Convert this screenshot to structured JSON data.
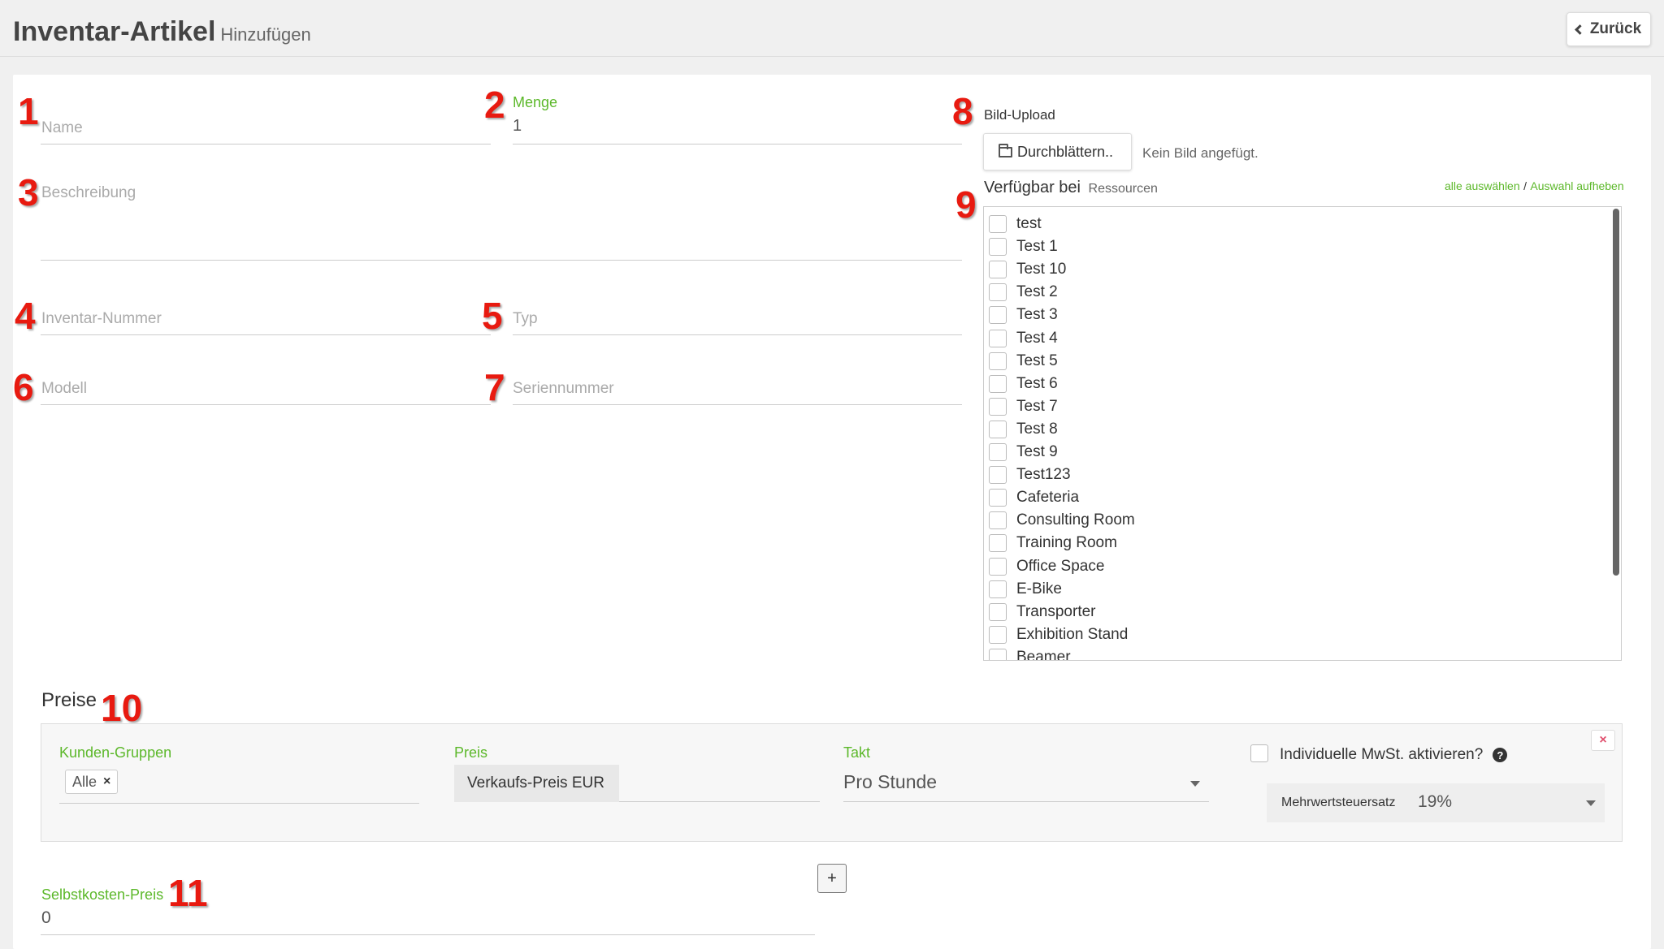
{
  "header": {
    "title": "Inventar-Artikel",
    "subtitle": "Hinzufügen",
    "back_label": "Zurück"
  },
  "markers": [
    "1",
    "2",
    "3",
    "4",
    "5",
    "6",
    "7",
    "8",
    "9",
    "10",
    "11"
  ],
  "form": {
    "name_placeholder": "Name",
    "menge_label": "Menge",
    "menge_value": "1",
    "beschreibung_placeholder": "Beschreibung",
    "inventar_nummer_placeholder": "Inventar-Nummer",
    "typ_placeholder": "Typ",
    "modell_placeholder": "Modell",
    "seriennummer_placeholder": "Seriennummer"
  },
  "upload": {
    "label": "Bild-Upload",
    "browse_label": "Durchblättern..",
    "no_image_text": "Kein Bild angefügt."
  },
  "availability": {
    "title": "Verfügbar bei",
    "subtitle": "Ressourcen",
    "select_all": "alle auswählen",
    "separator": "/",
    "deselect": "Auswahl aufheben",
    "resources": [
      "test",
      "Test 1",
      "Test 10",
      "Test 2",
      "Test 3",
      "Test 4",
      "Test 5",
      "Test 6",
      "Test 7",
      "Test 8",
      "Test 9",
      "Test123",
      "Cafeteria",
      "Consulting Room",
      "Training Room",
      "Office Space",
      "E-Bike",
      "Transporter",
      "Exhibition Stand",
      "Beamer"
    ]
  },
  "prices": {
    "title": "Preise",
    "kunden_label": "Kunden-Gruppen",
    "kunden_tag": "Alle",
    "tag_remove": "×",
    "preis_label": "Preis",
    "preis_addon": "Verkaufs-Preis EUR",
    "takt_label": "Takt",
    "takt_value": "Pro Stunde",
    "mwst_checkbox_label": "Individuelle MwSt. aktivieren?",
    "help_glyph": "?",
    "mwst_label": "Mehrwertsteuersatz",
    "mwst_value": "19%",
    "remove_glyph": "×",
    "add_glyph": "+"
  },
  "selbstkosten": {
    "label": "Selbstkosten-Preis",
    "value": "0"
  },
  "colors": {
    "accent_green": "#5cb82a",
    "marker_red": "#e81a10",
    "remove_pink": "#e0506e"
  }
}
